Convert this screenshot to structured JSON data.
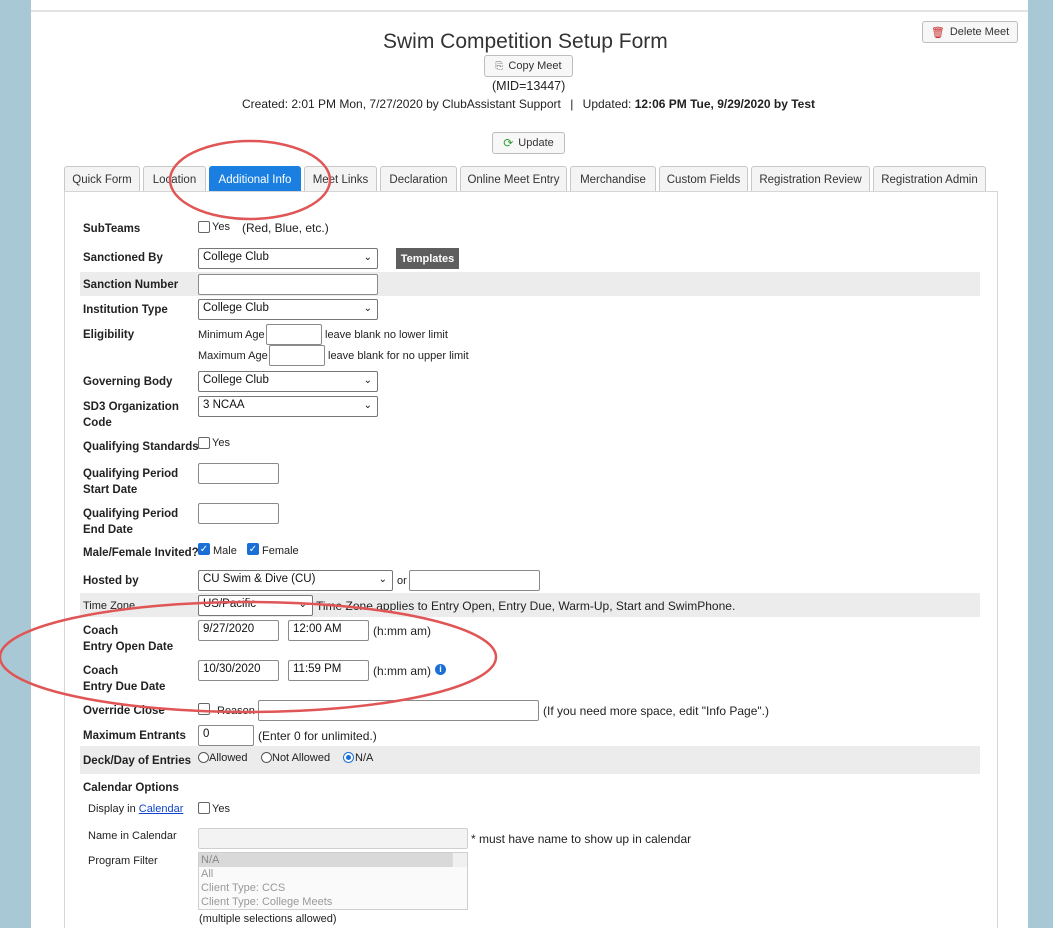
{
  "header": {
    "title": "Swim Competition Setup Form",
    "copy_meet": "Copy Meet",
    "delete_meet": "Delete Meet",
    "mid": "(MID=13447)",
    "created": "Created: 2:01 PM Mon, 7/27/2020 by ClubAssistant Support",
    "separator": "|",
    "updated_label": "Updated:",
    "updated_value": "12:06 PM Tue, 9/29/2020 by Test",
    "update_btn": "Update"
  },
  "tabs": [
    {
      "label": "Quick Form"
    },
    {
      "label": "Location"
    },
    {
      "label": "Additional Info"
    },
    {
      "label": "Meet Links"
    },
    {
      "label": "Declaration"
    },
    {
      "label": "Online Meet Entry"
    },
    {
      "label": "Merchandise"
    },
    {
      "label": "Custom Fields"
    },
    {
      "label": "Registration Review"
    },
    {
      "label": "Registration Admin"
    }
  ],
  "form": {
    "subteams_label": "SubTeams",
    "subteams_yes": "Yes",
    "subteams_hint": "(Red, Blue, etc.)",
    "sanctioned_by_label": "Sanctioned By",
    "sanctioned_by_value": "College Club",
    "templates_btn": "Templates",
    "sanction_number_label": "Sanction Number",
    "institution_type_label": "Institution Type",
    "institution_type_value": "College Club",
    "eligibility_label": "Eligibility",
    "min_age_label": "Minimum Age",
    "min_age_hint": "leave blank no lower limit",
    "max_age_label": "Maximum Age",
    "max_age_hint": "leave blank for no upper limit",
    "governing_body_label": "Governing Body",
    "governing_body_value": "College Club",
    "sd3_label_1": "SD3 Organization",
    "sd3_label_2": "Code",
    "sd3_value": "3 NCAA",
    "qual_standards_label": "Qualifying Standards",
    "qual_standards_yes": "Yes",
    "qual_start_label_1": "Qualifying Period",
    "qual_start_label_2": "Start Date",
    "qual_end_label_1": "Qualifying Period",
    "qual_end_label_2": "End Date",
    "mf_label": "Male/Female Invited?",
    "male": "Male",
    "female": "Female",
    "hosted_by_label": "Hosted by",
    "hosted_by_value": "CU Swim & Dive (CU)",
    "or": "or",
    "time_zone_label": "Time Zone",
    "time_zone_value": "US/Pacific",
    "time_zone_hint": "Time Zone applies to Entry Open, Entry Due, Warm-Up, Start and SwimPhone.",
    "open_label_1": "Coach",
    "open_label_2": "Entry Open Date",
    "open_date": "9/27/2020",
    "open_time": "12:00 AM",
    "time_hint": "(h:mm am)",
    "due_label_1": "Coach",
    "due_label_2": "Entry Due Date",
    "due_date": "10/30/2020",
    "due_time": "11:59 PM",
    "override_label": "Override Close",
    "reason_label": "Reason",
    "override_hint": "(If you need more space, edit \"Info Page\".)",
    "max_entrants_label": "Maximum Entrants",
    "max_entrants_value": "0",
    "max_entrants_hint": "(Enter 0 for unlimited.)",
    "deck_label": "Deck/Day of Entries",
    "deck_allowed": "Allowed",
    "deck_not_allowed": "Not Allowed",
    "deck_na": "N/A",
    "calendar_options_label": "Calendar Options",
    "display_in": "Display in",
    "calendar_link": "Calendar",
    "display_yes": "Yes",
    "name_in_calendar_label": "Name in Calendar",
    "name_hint": "* must have name to show up in calendar",
    "program_filter_label": "Program Filter",
    "program_filter_options": [
      "N/A",
      "All",
      "Client Type: CCS",
      "Client Type: College Meets"
    ],
    "multi_hint": "(multiple selections allowed)"
  },
  "colors": {
    "active_tab": "#1a7fe0",
    "annotation": "#e05555",
    "background": "#a9c8d6"
  }
}
